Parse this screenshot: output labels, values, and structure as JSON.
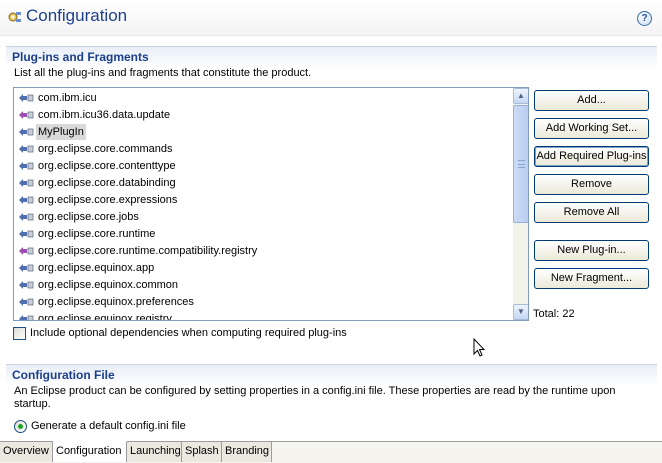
{
  "header": {
    "title": "Configuration",
    "help_label": "?"
  },
  "plugins_section": {
    "title": "Plug-ins and Fragments",
    "description": "List all the plug-ins and fragments that constitute the product.",
    "items": [
      {
        "label": "com.ibm.icu",
        "kind": "plugin"
      },
      {
        "label": "com.ibm.icu36.data.update",
        "kind": "fragment"
      },
      {
        "label": "MyPlugIn",
        "kind": "plugin"
      },
      {
        "label": "org.eclipse.core.commands",
        "kind": "plugin"
      },
      {
        "label": "org.eclipse.core.contenttype",
        "kind": "plugin"
      },
      {
        "label": "org.eclipse.core.databinding",
        "kind": "plugin"
      },
      {
        "label": "org.eclipse.core.expressions",
        "kind": "plugin"
      },
      {
        "label": "org.eclipse.core.jobs",
        "kind": "plugin"
      },
      {
        "label": "org.eclipse.core.runtime",
        "kind": "plugin"
      },
      {
        "label": "org.eclipse.core.runtime.compatibility.registry",
        "kind": "fragment"
      },
      {
        "label": "org.eclipse.equinox.app",
        "kind": "plugin"
      },
      {
        "label": "org.eclipse.equinox.common",
        "kind": "plugin"
      },
      {
        "label": "org.eclipse.equinox.preferences",
        "kind": "plugin"
      },
      {
        "label": "org.eclipse.equinox.registry",
        "kind": "plugin"
      }
    ],
    "selected_item": "MyPlugIn",
    "buttons": {
      "add": "Add...",
      "add_working_set": "Add Working Set...",
      "add_required": "Add Required Plug-ins",
      "remove": "Remove",
      "remove_all": "Remove All",
      "new_plugin": "New Plug-in...",
      "new_fragment": "New Fragment..."
    },
    "total": "Total: 22",
    "include_optional": {
      "label": "Include optional dependencies when computing required plug-ins",
      "checked": false
    }
  },
  "config_file_section": {
    "title": "Configuration File",
    "description": "An Eclipse product can be configured by setting properties in a config.ini file.  These properties are read by the runtime upon startup.",
    "radio": {
      "label": "Generate a default config.ini file",
      "selected": true
    }
  },
  "tabs": [
    {
      "label": "Overview",
      "active": false
    },
    {
      "label": "Configuration",
      "active": true
    },
    {
      "label": "Launching",
      "active": false
    },
    {
      "label": "Splash",
      "active": false
    },
    {
      "label": "Branding",
      "active": false
    }
  ],
  "colors": {
    "title_blue": "#1c3f8c",
    "plugin_icon": "#4f6fb0",
    "fragment_icon": "#9c4fb0",
    "radio_dot": "#21a121"
  },
  "icons": {
    "page": "configuration-gear-icon",
    "help": "help-icon",
    "plugin": "plugin-icon",
    "fragment": "fragment-icon"
  }
}
